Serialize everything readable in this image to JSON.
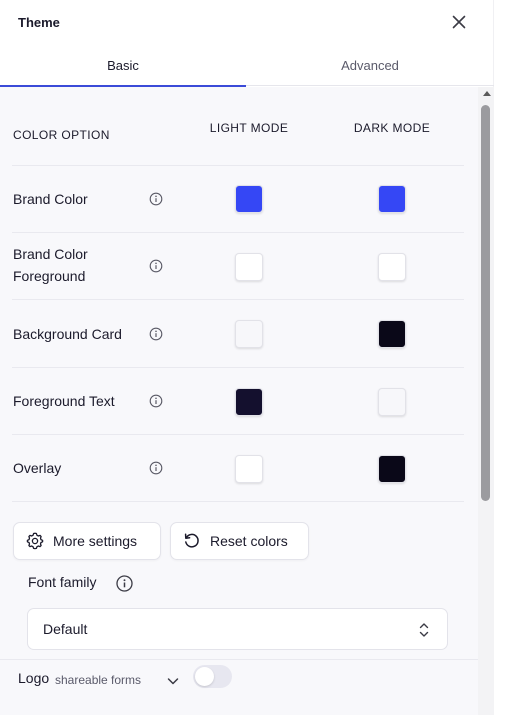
{
  "header": {
    "title": "Theme"
  },
  "tabs": [
    {
      "label": "Basic",
      "active": true
    },
    {
      "label": "Advanced",
      "active": false
    }
  ],
  "table": {
    "option_header": "COLOR OPTION",
    "light_header": "LIGHT MODE",
    "dark_header": "DARK MODE",
    "rows": [
      {
        "label": "Brand Color",
        "light": "#3547f5",
        "dark": "#3547f5"
      },
      {
        "label": "Brand Color Foreground",
        "light": "#ffffff",
        "dark": "#ffffff"
      },
      {
        "label": "Background Card",
        "light": "#f7f7fa",
        "dark": "#0a0818"
      },
      {
        "label": "Foreground Text",
        "light": "#14102e",
        "dark": "#f7f7fa"
      },
      {
        "label": "Overlay",
        "light": "#ffffff",
        "dark": "#0a0818"
      }
    ]
  },
  "buttons": {
    "more_settings": "More settings",
    "reset_colors": "Reset colors"
  },
  "font_family": {
    "label": "Font family",
    "value": "Default"
  },
  "logo": {
    "label": "Logo",
    "sublabel": "shareable forms",
    "toggle_on": false
  },
  "colors": {
    "accent": "#3b4bd8",
    "background": "#f8f8fb"
  }
}
